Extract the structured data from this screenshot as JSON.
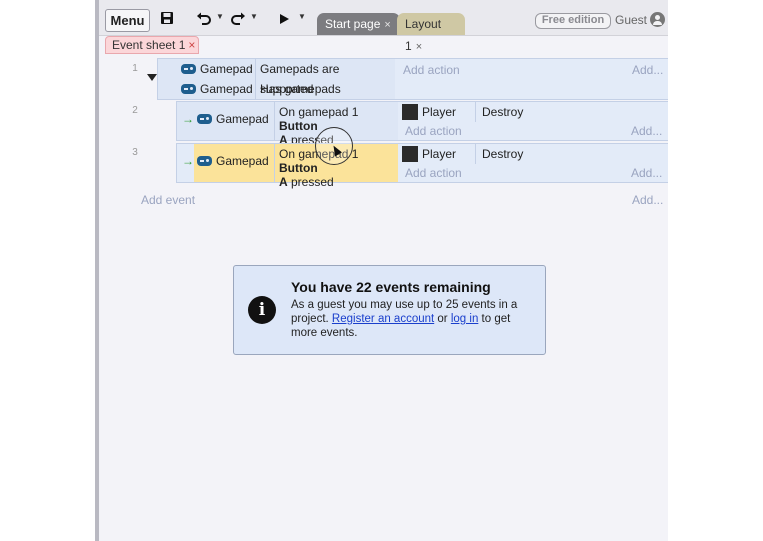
{
  "toolbar": {
    "menu_label": "Menu",
    "save_icon": "save-icon",
    "undo_icon": "undo-icon",
    "redo_icon": "redo-icon",
    "play_icon": "play-icon",
    "tabs": [
      {
        "label": "Start page",
        "close": "×"
      },
      {
        "label": "Layout 1",
        "close": "×"
      }
    ],
    "edition_badge": "Free edition",
    "user_label": "Guest"
  },
  "sheet_tab": {
    "label": "Event sheet 1",
    "close": "×"
  },
  "events": [
    {
      "number": "1",
      "conditions": [
        {
          "object": "Gamepad",
          "text": "Gamepads are supported"
        },
        {
          "object": "Gamepad",
          "text": "Has gamepads"
        }
      ],
      "add_action": "Add action",
      "add_more": "Add..."
    },
    {
      "number": "2",
      "condition": {
        "object": "Gamepad",
        "text_pre": "On gamepad 1 ",
        "text_bold1": "Button",
        "text_bold2": "A",
        "text_post": " pressed"
      },
      "action": {
        "object": "Player",
        "verb": "Destroy"
      },
      "add_action": "Add action",
      "add_more": "Add..."
    },
    {
      "number": "3",
      "condition": {
        "object": "Gamepad",
        "text_pre": "On gamepad 1 ",
        "text_bold1": "Button",
        "text_bold2": "A",
        "text_post": " pressed"
      },
      "action": {
        "object": "Player",
        "verb": "Destroy"
      },
      "add_action": "Add action",
      "add_more": "Add..."
    }
  ],
  "add_event": "Add event",
  "add_event_more": "Add...",
  "notice": {
    "title": "You have 22 events remaining",
    "body_pre": "As a guest you may use up to 25 events in a project. ",
    "link_register": "Register an account",
    "body_or": " or ",
    "link_login": "log in",
    "body_post": " to get more events."
  },
  "colors": {
    "event_block": "#e3ebf8",
    "selected_highlight": "#fbe39a",
    "sheet_tab": "#fbd6d9",
    "link": "#1a3fcc"
  }
}
